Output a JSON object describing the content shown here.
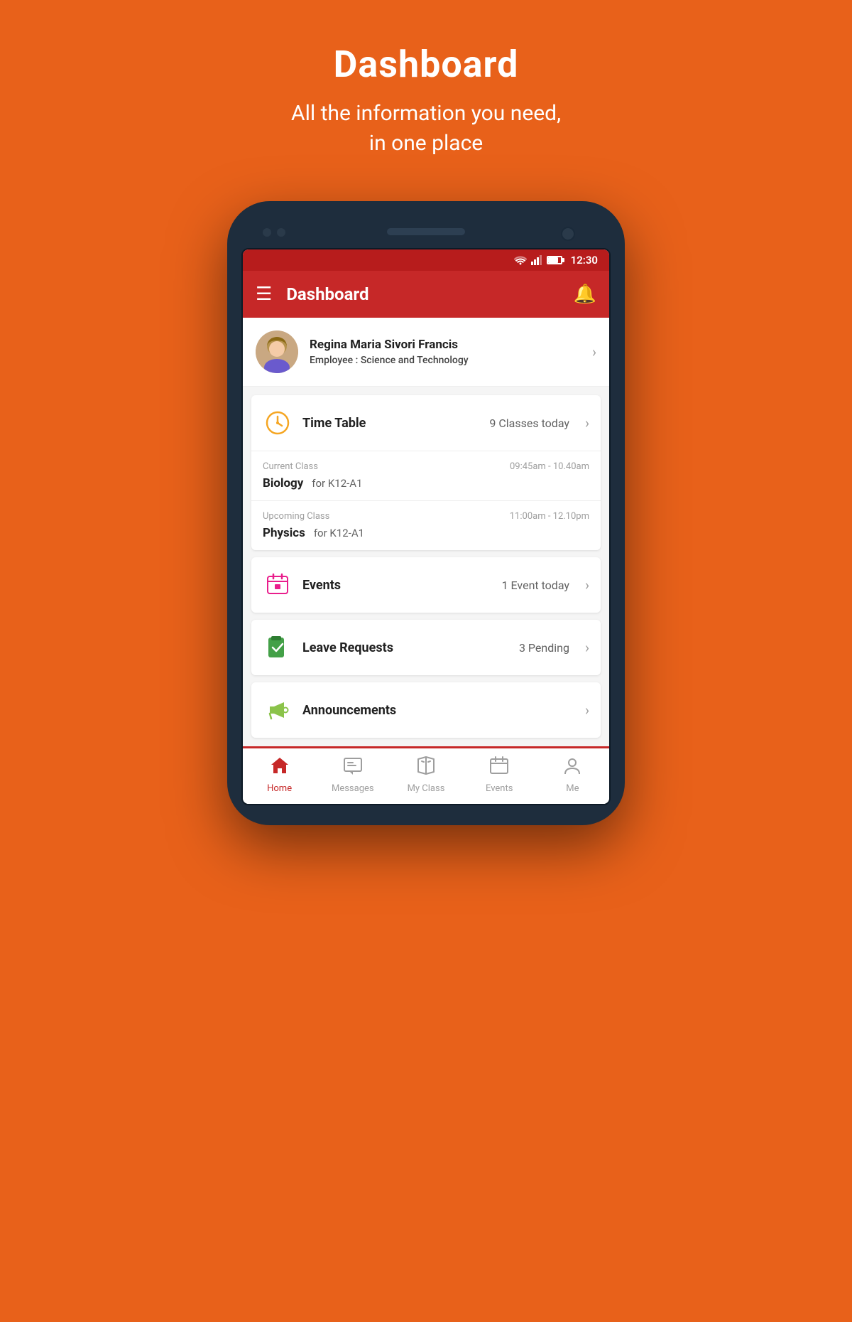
{
  "header": {
    "title": "Dashboard",
    "subtitle_line1": "All the information you need,",
    "subtitle_line2": "in one place"
  },
  "statusBar": {
    "time": "12:30"
  },
  "appBar": {
    "title": "Dashboard",
    "bellLabel": "Notifications"
  },
  "profile": {
    "name": "Regina Maria Sivori Francis",
    "role_label": "Employee : ",
    "role_value": "Science and Technology"
  },
  "timetable": {
    "label": "Time Table",
    "count": "9 Classes today",
    "currentClass": {
      "label": "Current Class",
      "time": "09:45am - 10.40am",
      "subject": "Biology",
      "group": "for K12-A1"
    },
    "upcomingClass": {
      "label": "Upcoming Class",
      "time": "11:00am - 12.10pm",
      "subject": "Physics",
      "group": "for K12-A1"
    }
  },
  "events": {
    "label": "Events",
    "count": "1 Event today"
  },
  "leaveRequests": {
    "label": "Leave Requests",
    "count": "3 Pending"
  },
  "announcements": {
    "label": "Announcements",
    "count": ""
  },
  "bottomNav": {
    "items": [
      {
        "label": "Home",
        "active": true
      },
      {
        "label": "Messages",
        "active": false
      },
      {
        "label": "My Class",
        "active": false
      },
      {
        "label": "Events",
        "active": false
      },
      {
        "label": "Me",
        "active": false
      }
    ]
  },
  "colors": {
    "primary": "#c62828",
    "orange": "#E8611A",
    "timetable_icon": "#f5a623",
    "events_icon": "#e91e8c",
    "leave_icon": "#43a047",
    "announce_icon": "#8bc34a"
  }
}
